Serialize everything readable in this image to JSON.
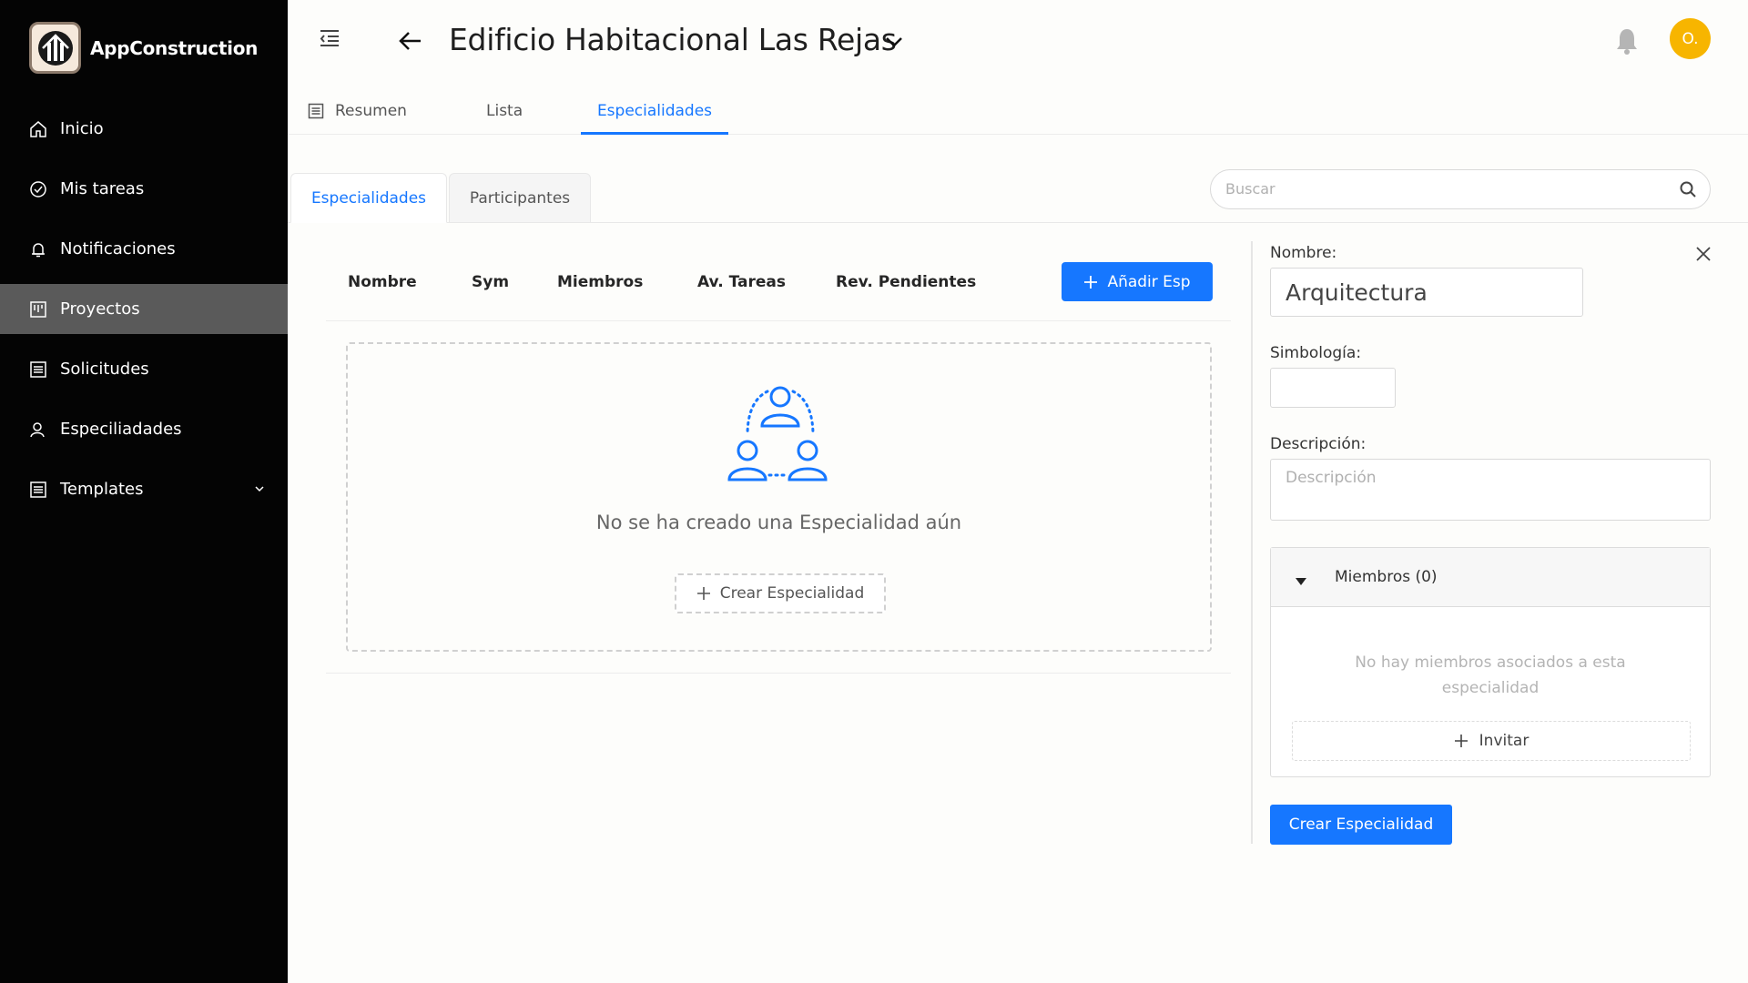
{
  "app": {
    "name": "AppConstruction"
  },
  "sidebar": {
    "items": [
      {
        "label": "Inicio",
        "icon": "home-icon"
      },
      {
        "label": "Mis tareas",
        "icon": "check-circle-icon"
      },
      {
        "label": "Notificaciones",
        "icon": "bell-icon"
      },
      {
        "label": "Proyectos",
        "icon": "project-icon",
        "active": true
      },
      {
        "label": "Solicitudes",
        "icon": "list-icon"
      },
      {
        "label": "Especiliadades",
        "icon": "user-icon"
      },
      {
        "label": "Templates",
        "icon": "list-icon",
        "expandable": true
      }
    ]
  },
  "header": {
    "project_title": "Edificio Habitacional Las Rejas",
    "avatar_initial": "O.",
    "tabs": [
      {
        "label": "Resumen"
      },
      {
        "label": "Lista"
      },
      {
        "label": "Especialidades",
        "active": true
      }
    ]
  },
  "subtabs": [
    {
      "label": "Especialidades",
      "active": true
    },
    {
      "label": "Participantes"
    }
  ],
  "search": {
    "placeholder": "Buscar"
  },
  "table": {
    "columns": [
      "Nombre",
      "Sym",
      "Miembros",
      "Av. Tareas",
      "Rev. Pendientes"
    ],
    "add_button": "Añadir Esp",
    "empty_message": "No se ha creado una Especialidad aún",
    "empty_create": "Crear Especialidad"
  },
  "form": {
    "name_label": "Nombre:",
    "name_value": "Arquitectura",
    "symbol_label": "Simbología:",
    "symbol_value": "",
    "description_label": "Descripción:",
    "description_placeholder": "Descripción",
    "members_header": "Miembros (0)",
    "members_empty": "No hay miembros asociados a esta especialidad",
    "invite_label": "Invitar",
    "submit_label": "Crear Especialidad"
  },
  "colors": {
    "accent": "#1677ff",
    "sidebar_bg": "#040404",
    "sidebar_active": "#5a5a5a",
    "avatar": "#f7b500"
  }
}
